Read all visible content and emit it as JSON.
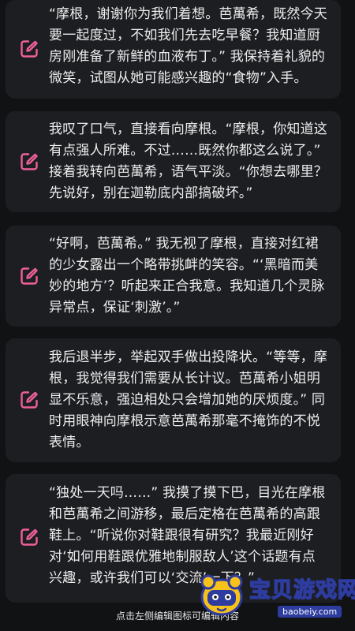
{
  "entries": [
    {
      "text": "“摩根，谢谢你为我们着想。芭萬希，既然今天要一起度过，不如我们先去吃早餐？我知道厨房刚准备了新鲜的血液布丁。” 我保持着礼貌的微笑，试图从她可能感兴趣的“食物”入手。"
    },
    {
      "text": "我叹了口气，直接看向摩根。“摩根，你知道这有点强人所难。不过……既然你都这么说了。” 接着我转向芭萬希，语气平淡。“你想去哪里？先说好，别在迦勒底内部搞破坏。”"
    },
    {
      "text": "“好啊，芭萬希。” 我无视了摩根，直接对红裙的少女露出一个略带挑衅的笑容。“‘黑暗而美妙的地方’？听起来正合我意。我知道几个灵脉异常点，保证‘刺激’。”"
    },
    {
      "text": "我后退半步，举起双手做出投降状。“等等，摩根，我觉得我们需要从长计议。芭萬希小姐明显不乐意，强迫相处只会增加她的厌烦度。” 同时用眼神向摩根示意芭萬希那毫不掩饰的不悦表情。"
    },
    {
      "text": "“独处一天吗……” 我摸了摸下巴，目光在摩根和芭萬希之间游移，最后定格在芭萬希的高跟鞋上。“听说你对鞋跟很有研究？我最近刚好对‘如何用鞋跟优雅地制服敌人’这个话题有点兴趣，或许我们可以‘交流’一下？”"
    }
  ],
  "footer_hint": "点击左侧编辑图标可编辑内容",
  "watermark": {
    "title": "宝贝游戏网",
    "url": "baobeiy.com"
  },
  "colors": {
    "background": "#111214",
    "card": "#1d1e22",
    "edit_icon": "#f0609b",
    "text": "#ededed"
  },
  "icons": {
    "edit": "edit-icon"
  }
}
